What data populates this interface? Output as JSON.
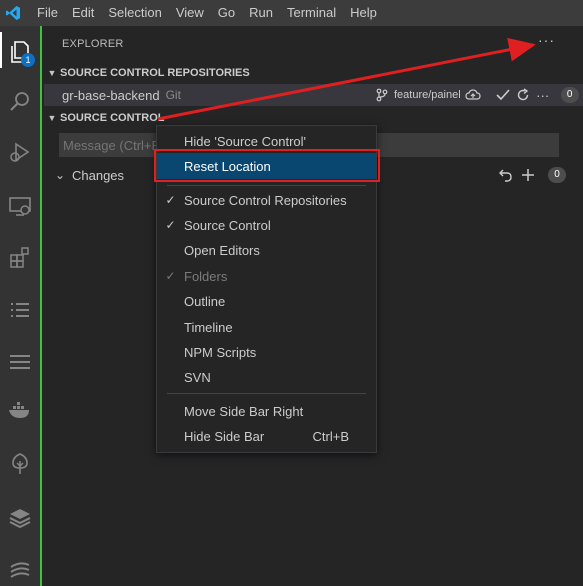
{
  "titlebar": {
    "menus": [
      "File",
      "Edit",
      "Selection",
      "View",
      "Go",
      "Run",
      "Terminal",
      "Help"
    ]
  },
  "activitybar": {
    "badge": "1",
    "icons": [
      "explorer-icon",
      "search-icon",
      "run-debug-icon",
      "remote-explorer-icon",
      "extensions-icon",
      "list-icon",
      "menu-icon",
      "docker-icon",
      "tree-icon",
      "database-icon",
      "stack-icon"
    ]
  },
  "sidebar": {
    "title": "EXPLORER",
    "more": "···",
    "repos_section": "SOURCE CONTROL REPOSITORIES",
    "repo": {
      "name": "gr-base-backend",
      "provider": "Git",
      "branch": "feature/painel",
      "count": "0"
    },
    "sc_section": "SOURCE CONTROL",
    "message_placeholder": "Message (Ctrl+E",
    "changes": {
      "label": "Changes",
      "count": "0"
    }
  },
  "context_menu": {
    "items": [
      {
        "label": "Hide 'Source Control'",
        "checked": false
      },
      {
        "label": "Reset Location",
        "checked": false,
        "selected": true
      },
      {
        "label": "Source Control Repositories",
        "checked": true
      },
      {
        "label": "Source Control",
        "checked": true
      },
      {
        "label": "Open Editors",
        "checked": false
      },
      {
        "label": "Folders",
        "checked": true,
        "disabled": true
      },
      {
        "label": "Outline",
        "checked": false
      },
      {
        "label": "Timeline",
        "checked": false
      },
      {
        "label": "NPM Scripts",
        "checked": false
      },
      {
        "label": "SVN",
        "checked": false
      },
      {
        "label": "Move Side Bar Right",
        "checked": false
      },
      {
        "label": "Hide Side Bar",
        "checked": false,
        "shortcut": "Ctrl+B"
      }
    ]
  },
  "colors": {
    "accent": "#0e70c0",
    "selection": "#094771",
    "annotation": "#e02020",
    "sidebar_border": "#3ec53e"
  }
}
